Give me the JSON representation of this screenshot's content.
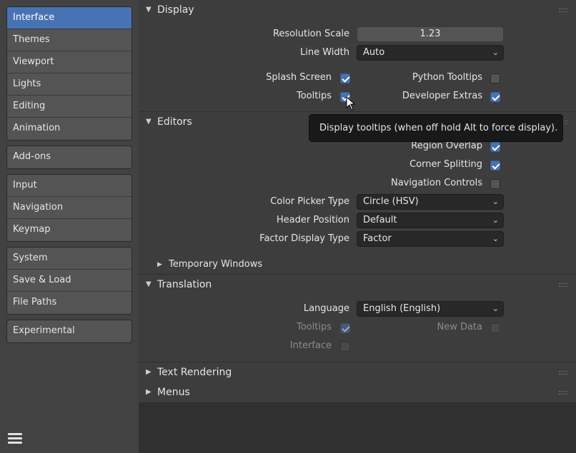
{
  "sidebar": {
    "groups": [
      [
        "Interface",
        "Themes",
        "Viewport",
        "Lights",
        "Editing",
        "Animation"
      ],
      [
        "Add-ons"
      ],
      [
        "Input",
        "Navigation",
        "Keymap"
      ],
      [
        "System",
        "Save & Load",
        "File Paths"
      ],
      [
        "Experimental"
      ]
    ],
    "active": "Interface"
  },
  "display": {
    "title": "Display",
    "resolution_scale_label": "Resolution Scale",
    "resolution_scale_value": "1.23",
    "line_width_label": "Line Width",
    "line_width_value": "Auto",
    "splash_screen_label": "Splash Screen",
    "splash_screen": true,
    "python_tooltips_label": "Python Tooltips",
    "python_tooltips": false,
    "tooltips_label": "Tooltips",
    "tooltips": true,
    "developer_extras_label": "Developer Extras",
    "developer_extras": true
  },
  "editors": {
    "title": "Editors",
    "region_overlap_label": "Region Overlap",
    "region_overlap": true,
    "corner_splitting_label": "Corner Splitting",
    "corner_splitting": true,
    "navigation_controls_label": "Navigation Controls",
    "navigation_controls": false,
    "color_picker_label": "Color Picker Type",
    "color_picker_value": "Circle (HSV)",
    "header_position_label": "Header Position",
    "header_position_value": "Default",
    "factor_display_label": "Factor Display Type",
    "factor_display_value": "Factor",
    "temporary_windows_label": "Temporary Windows"
  },
  "translation": {
    "title": "Translation",
    "language_label": "Language",
    "language_value": "English (English)",
    "tooltips_label": "Tooltips",
    "tooltips": true,
    "new_data_label": "New Data",
    "new_data": false,
    "interface_label": "Interface",
    "interface": false
  },
  "text_rendering": {
    "title": "Text Rendering"
  },
  "menus": {
    "title": "Menus"
  },
  "tooltip": {
    "text": "Display tooltips (when off hold Alt to force display)."
  },
  "colors": {
    "accent": "#4772b3",
    "panel": "#3d3d3d",
    "background": "#303030",
    "sidebar": "#424242"
  }
}
